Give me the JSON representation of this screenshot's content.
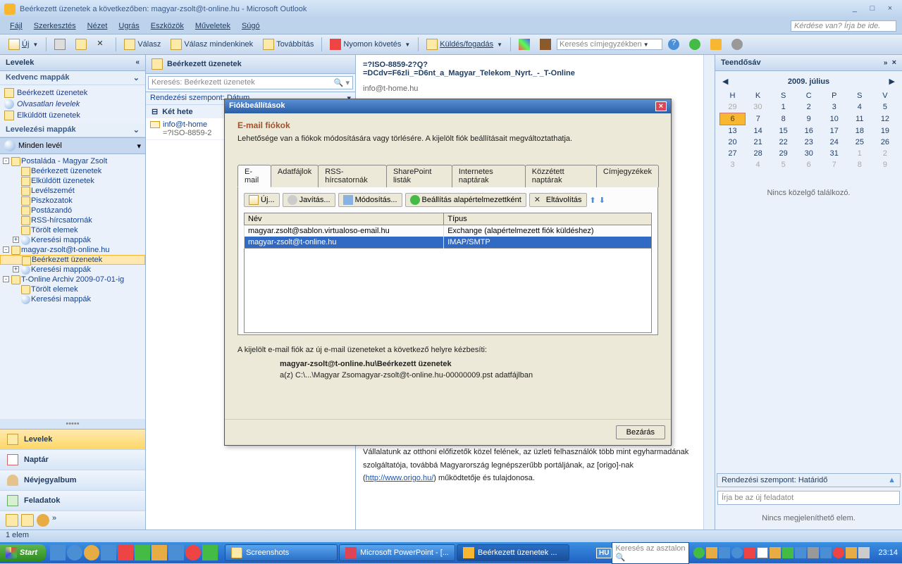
{
  "window": {
    "title": "Beérkezett üzenetek a következőben: magyar-zsolt@t-online.hu - Microsoft Outlook",
    "help_placeholder": "Kérdése van? Írja be ide."
  },
  "menubar": [
    "Fájl",
    "Szerkesztés",
    "Nézet",
    "Ugrás",
    "Eszközök",
    "Műveletek",
    "Súgó"
  ],
  "toolbar": {
    "new": "Új",
    "reply": "Válasz",
    "replyall": "Válasz mindenkinek",
    "forward": "Továbbítás",
    "follow": "Nyomon követés",
    "sendrecv": "Küldés/fogadás",
    "searchab": "Keresés címjegyzékben"
  },
  "nav": {
    "title": "Levelek",
    "fav_header": "Kedvenc mappák",
    "fav": [
      "Beérkezett üzenetek",
      "Olvasatlan levelek",
      "Elküldött üzenetek"
    ],
    "mail_header": "Levelezési mappák",
    "allmail": "Minden levél",
    "tree": [
      {
        "t": "Postaláda - Magyar Zsolt",
        "lvl": 0,
        "ex": "-",
        "ic": "i-fld"
      },
      {
        "t": "Beérkezett üzenetek",
        "lvl": 1,
        "ic": "i-mail"
      },
      {
        "t": "Elküldött üzenetek",
        "lvl": 1,
        "ic": "i-mail"
      },
      {
        "t": "Levélszemét",
        "lvl": 1,
        "ic": "i-fld"
      },
      {
        "t": "Piszkozatok",
        "lvl": 1,
        "ic": "i-fld"
      },
      {
        "t": "Postázandó",
        "lvl": 1,
        "ic": "i-fld"
      },
      {
        "t": "RSS-hírcsatornák",
        "lvl": 1,
        "ic": "i-fld"
      },
      {
        "t": "Törölt elemek",
        "lvl": 1,
        "ic": "i-fld"
      },
      {
        "t": "Keresési mappák",
        "lvl": 1,
        "ex": "+",
        "ic": "i-search"
      },
      {
        "t": "magyar-zsolt@t-online.hu",
        "lvl": 0,
        "ex": "-",
        "ic": "i-fld"
      },
      {
        "t": "Beérkezett üzenetek",
        "lvl": 1,
        "sel": true,
        "ic": "i-mail"
      },
      {
        "t": "Keresési mappák",
        "lvl": 1,
        "ex": "+",
        "ic": "i-search"
      },
      {
        "t": "T-Online Archiv 2009-07-01-ig",
        "lvl": 0,
        "ex": "-",
        "ic": "i-fld"
      },
      {
        "t": "Törölt elemek",
        "lvl": 1,
        "ic": "i-fld"
      },
      {
        "t": "Keresési mappák",
        "lvl": 1,
        "ic": "i-search"
      }
    ],
    "buttons": [
      "Levelek",
      "Naptár",
      "Névjegyalbum",
      "Feladatok"
    ]
  },
  "list": {
    "header": "Beérkezett üzenetek",
    "search_ph": "Keresés: Beérkezett üzenetek",
    "sort": "Rendezési szempont: Dátum",
    "group": "Két hete",
    "items": [
      {
        "from": "info@t-home",
        "subj": "=?ISO-8859-2"
      }
    ]
  },
  "reading": {
    "subject1": "=?ISO-8859-2?Q?",
    "subject2": "=DCdv=F6zli_=D6nt_a_Magyar_Telekom_Nyrt._-_T-Online",
    "from": "info@t-home.hu",
    "body": "Vállalatunk az otthoni előfizetők közel felének, az üzleti felhasználók több mint egyharmadának szolgáltatója, továbbá Magyarország legnépszerűbb portáljának, az [origo]-nak (",
    "link": "http://www.origo.hu/",
    "body2": ") működtetője és tulajdonosa."
  },
  "todo": {
    "title": "Teendősáv",
    "cal_title": "2009. július",
    "days": [
      "H",
      "K",
      "S",
      "C",
      "P",
      "S",
      "V"
    ],
    "weeks": [
      [
        {
          "d": 29,
          "dim": 1
        },
        {
          "d": 30,
          "dim": 1
        },
        {
          "d": 1
        },
        {
          "d": 2
        },
        {
          "d": 3
        },
        {
          "d": 4
        },
        {
          "d": 5
        }
      ],
      [
        {
          "d": 6,
          "today": 1
        },
        {
          "d": 7
        },
        {
          "d": 8
        },
        {
          "d": 9
        },
        {
          "d": 10
        },
        {
          "d": 11
        },
        {
          "d": 12
        }
      ],
      [
        {
          "d": 13
        },
        {
          "d": 14
        },
        {
          "d": 15
        },
        {
          "d": 16
        },
        {
          "d": 17
        },
        {
          "d": 18
        },
        {
          "d": 19
        }
      ],
      [
        {
          "d": 20
        },
        {
          "d": 21
        },
        {
          "d": 22
        },
        {
          "d": 23
        },
        {
          "d": 24
        },
        {
          "d": 25
        },
        {
          "d": 26
        }
      ],
      [
        {
          "d": 27
        },
        {
          "d": 28
        },
        {
          "d": 29
        },
        {
          "d": 30
        },
        {
          "d": 31
        },
        {
          "d": 1,
          "dim": 1
        },
        {
          "d": 2,
          "dim": 1
        }
      ],
      [
        {
          "d": 3,
          "dim": 1
        },
        {
          "d": 4,
          "dim": 1
        },
        {
          "d": 5,
          "dim": 1
        },
        {
          "d": 6,
          "dim": 1
        },
        {
          "d": 7,
          "dim": 1
        },
        {
          "d": 8,
          "dim": 1
        },
        {
          "d": 9,
          "dim": 1
        }
      ]
    ],
    "noappt": "Nincs közelgő találkozó.",
    "sort": "Rendezési szempont: Határidő",
    "task_ph": "Írja be az új feladatot",
    "notask": "Nincs megjeleníthető elem."
  },
  "dialog": {
    "title": "Fiókbeállítások",
    "h3": "E-mail fiókok",
    "desc": "Lehetősége van a fiókok módosítására vagy törlésére. A kijelölt fiók beállításait megváltoztathatja.",
    "tabs": [
      "E-mail",
      "Adatfájlok",
      "RSS-hírcsatornák",
      "SharePoint listák",
      "Internetes naptárak",
      "Közzétett naptárak",
      "Címjegyzékek"
    ],
    "btns": {
      "new": "Új...",
      "repair": "Javítás...",
      "modify": "Módosítás...",
      "default": "Beállítás alapértelmezettként",
      "remove": "Eltávolítás"
    },
    "cols": [
      "Név",
      "Típus"
    ],
    "rows": [
      {
        "name": "magyar.zsolt@sablon.virtualoso-email.hu",
        "type": "Exchange (alapértelmezett fiók küldéshez)"
      },
      {
        "name": "magyar-zsolt@t-online.hu",
        "type": "IMAP/SMTP",
        "sel": true
      }
    ],
    "info1": "A kijelölt e-mail fiók az új e-mail üzeneteket a következő helyre kézbesíti:",
    "info2": "magyar-zsolt@t-online.hu\\Beérkezett üzenetek",
    "info3": "a(z) C:\\...\\Magyar Zsomagyar-zsolt@t-online.hu-00000009.pst adatfájlban",
    "close": "Bezárás"
  },
  "status": "1 elem",
  "taskbar": {
    "start": "Start",
    "tasks": [
      "Screenshots",
      "Microsoft PowerPoint - [...",
      "Beérkezett üzenetek ..."
    ],
    "lang": "HU",
    "search_ph": "Keresés az asztalon",
    "clock": "23:14"
  }
}
